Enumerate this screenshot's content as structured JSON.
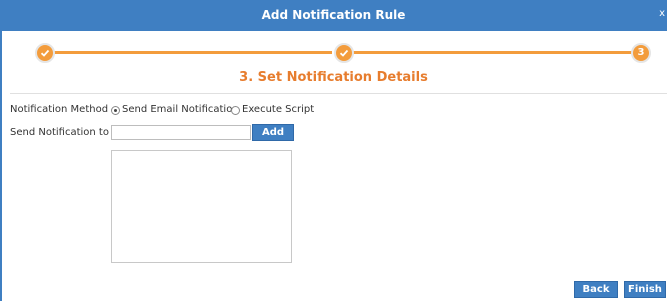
{
  "dialog": {
    "title": "Add Notification Rule",
    "close_symbol": "x"
  },
  "stepper": {
    "steps": [
      {
        "state": "completed",
        "icon": "check-icon"
      },
      {
        "state": "completed",
        "icon": "check-icon"
      },
      {
        "state": "current",
        "number": "3"
      }
    ],
    "color": "#f39c3c"
  },
  "section": {
    "heading": "3. Set Notification Details"
  },
  "form": {
    "method_label": "Notification Method",
    "method_options": [
      {
        "label": "Send Email Notification",
        "selected": true
      },
      {
        "label": "Execute Script",
        "selected": false
      }
    ],
    "send_to_label": "Send Notification to",
    "send_to_value": "",
    "add_label": "Add",
    "recipients_value": ""
  },
  "footer": {
    "back_label": "Back",
    "finish_label": "Finish"
  },
  "colors": {
    "accent": "#3f7fc2",
    "heading": "#e77d2e"
  }
}
